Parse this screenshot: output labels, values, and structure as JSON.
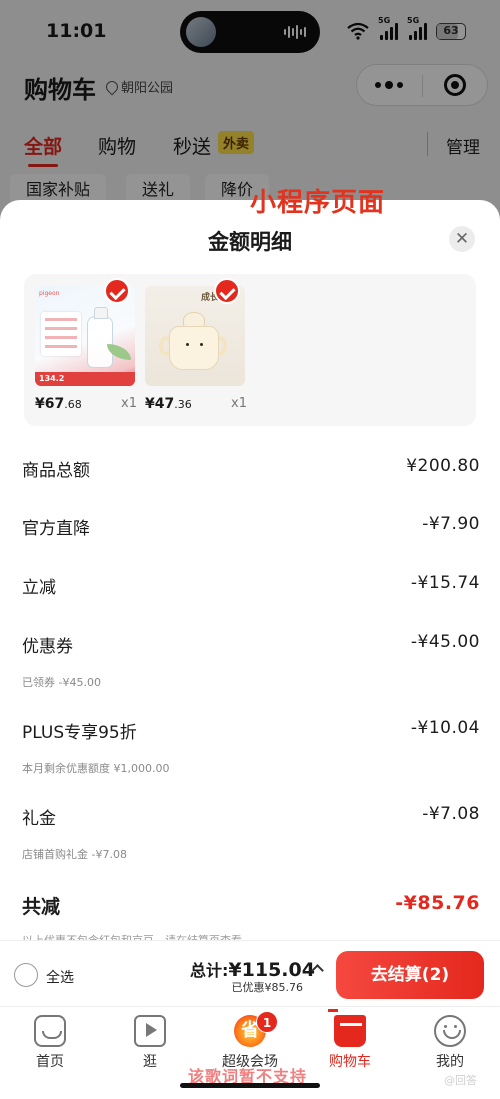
{
  "status_bar": {
    "time": "11:01",
    "signal1": "5G",
    "signal2": "5G",
    "battery": "63"
  },
  "header": {
    "title": "购物车",
    "location": "朝阳公园"
  },
  "tabs": [
    {
      "label": "全部"
    },
    {
      "label": "购物"
    },
    {
      "label": "秒送"
    }
  ],
  "waimai_tag": "外卖",
  "manage_label": "管理",
  "filters": [
    "国家补贴",
    "送礼",
    "降价"
  ],
  "overlay_label": "小程序页面",
  "sheet": {
    "title": "金额明细",
    "products": [
      {
        "price_int": "¥67",
        "price_dec": ".68",
        "qty": "x1",
        "banner": "134.2"
      },
      {
        "price_int": "¥47",
        "price_dec": ".36",
        "qty": "x1",
        "banner": "成长"
      }
    ],
    "rows": [
      {
        "label": "商品总额",
        "value": "¥200.80"
      },
      {
        "label": "官方直降",
        "value": "-¥7.90"
      },
      {
        "label": "立减",
        "value": "-¥15.74"
      },
      {
        "label": "优惠券",
        "value": "-¥45.00",
        "sub": "已领券 -¥45.00"
      },
      {
        "label": "PLUS专享95折",
        "value": "-¥10.04",
        "sub": "本月剩余优惠额度 ¥1,000.00"
      },
      {
        "label": "礼金",
        "value": "-¥7.08",
        "sub": "店铺首购礼金 -¥7.08"
      }
    ],
    "total": {
      "label": "共减",
      "value": "-¥85.76"
    },
    "note": "以上优惠不包含红包和京豆，请在结算页查看"
  },
  "checkout": {
    "select_all": "全选",
    "total_prefix": "总计:",
    "total_value": "¥115.04",
    "discount": "已优惠¥85.76",
    "pay_button": "去结算(2)"
  },
  "tabbar": [
    {
      "label": "首页",
      "icon": "home-icon"
    },
    {
      "label": "逛",
      "icon": "play-icon"
    },
    {
      "label": "超级会场",
      "icon": "venue-icon",
      "badge": "1"
    },
    {
      "label": "购物车",
      "icon": "cart-icon"
    },
    {
      "label": "我的",
      "icon": "face-icon"
    }
  ],
  "lyric_overlay": "该歌词暂不支持",
  "watermark": "@回答",
  "colors": {
    "accent": "#e4281e",
    "waimai": "#ffe04a"
  }
}
